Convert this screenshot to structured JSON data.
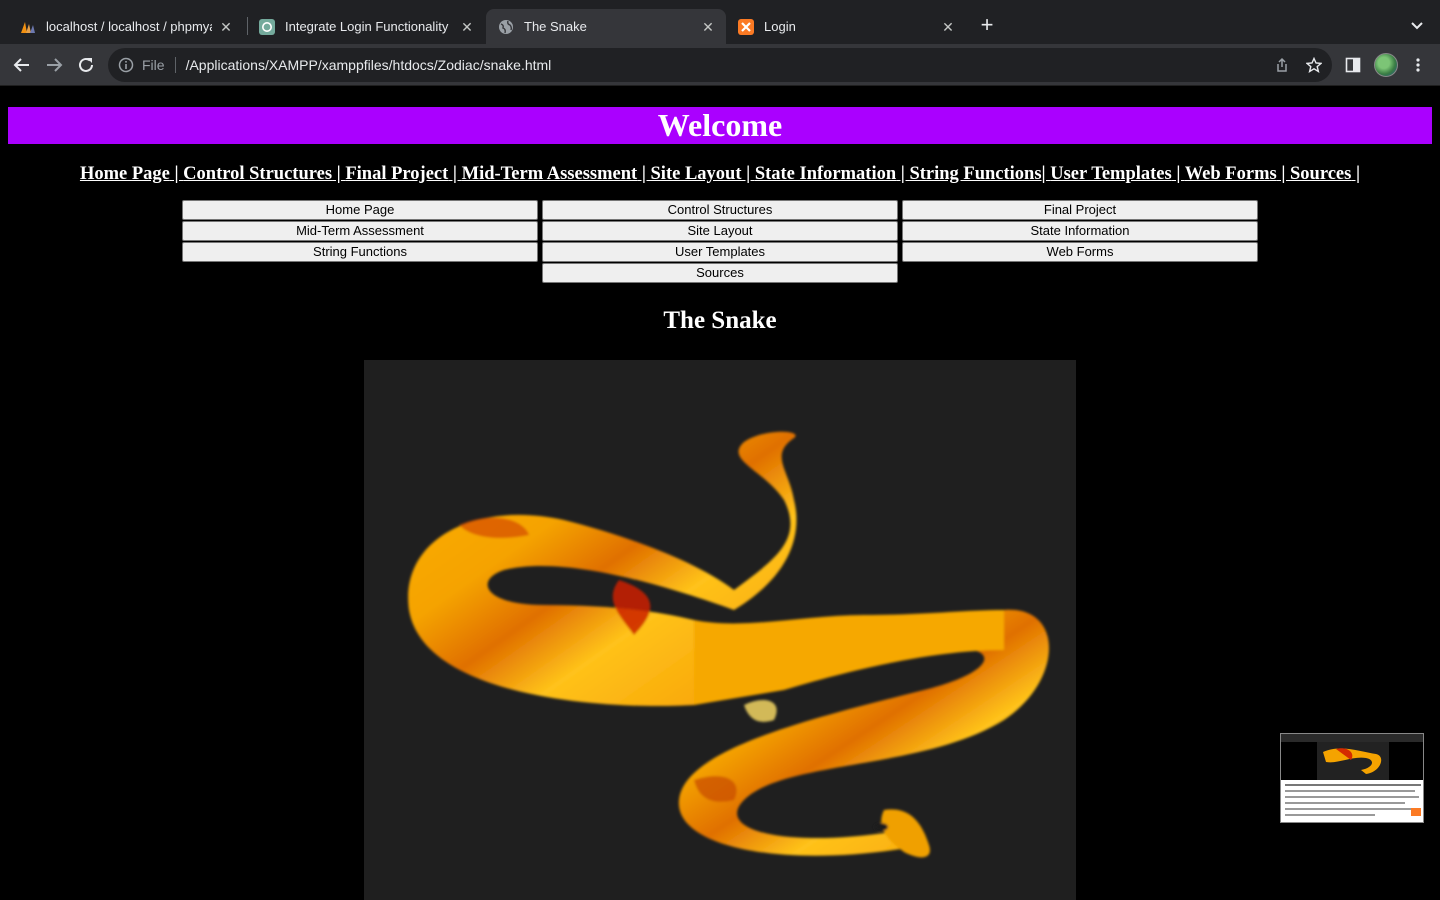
{
  "browser": {
    "tabs": [
      {
        "title": "localhost / localhost / phpmyadmin",
        "icon": "phpmyadmin-icon",
        "active": false
      },
      {
        "title": "Integrate Login Functionality",
        "icon": "chatgpt-icon",
        "active": false
      },
      {
        "title": "The Snake",
        "icon": "globe-icon",
        "active": true
      },
      {
        "title": "Login",
        "icon": "xampp-icon",
        "active": false
      }
    ],
    "address": {
      "scheme_label": "File",
      "url": "/Applications/XAMPP/xamppfiles/htdocs/Zodiac/snake.html"
    }
  },
  "page": {
    "welcome": "Welcome",
    "nav_links": [
      {
        "label": "Home Page",
        "sep": " | "
      },
      {
        "label": "Control Structures",
        "sep": " | "
      },
      {
        "label": "Final Project",
        "sep": " | "
      },
      {
        "label": "Mid-Term Assessment",
        "sep": " | "
      },
      {
        "label": "Site Layout",
        "sep": " | "
      },
      {
        "label": "State Information",
        "sep": " | "
      },
      {
        "label": "String Functions",
        "sep": "| "
      },
      {
        "label": "User Templates",
        "sep": " | "
      },
      {
        "label": "Web Forms",
        "sep": " | "
      },
      {
        "label": "Sources",
        "sep": " |"
      }
    ],
    "nav_buttons": [
      "Home Page",
      "Control Structures",
      "Final Project",
      "Mid-Term Assessment",
      "Site Layout",
      "State Information",
      "String Functions",
      "User Templates",
      "Web Forms",
      "Sources"
    ],
    "heading": "The Snake",
    "image": {
      "subject": "snake-illustration",
      "background_color": "#1f1f1f"
    }
  },
  "colors": {
    "banner": "#aa00ff",
    "page_bg": "#000000",
    "tabstrip_bg": "#202124",
    "toolbar_bg": "#35363a"
  }
}
